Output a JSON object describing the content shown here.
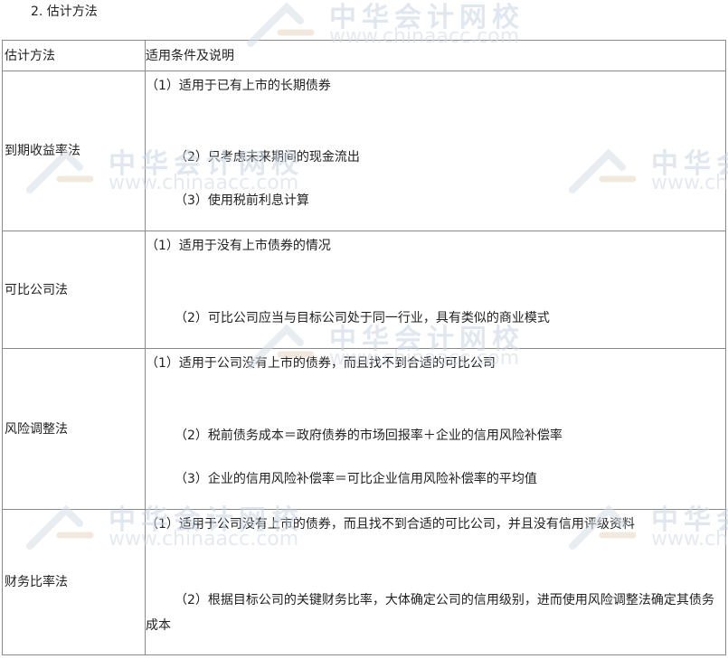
{
  "heading": "2. 估计方法",
  "table": {
    "header": [
      "估计方法",
      "适用条件及说明"
    ],
    "rows": [
      {
        "method": "到期收益率法",
        "conditions": [
          "（1）适用于已有上市的长期债券",
          "（2）只考虑未来期间的现金流出",
          "（3）使用税前利息计算"
        ]
      },
      {
        "method": "可比公司法",
        "conditions": [
          "（1）适用于没有上市债券的情况",
          "（2）可比公司应当与目标公司处于同一行业，具有类似的商业模式"
        ]
      },
      {
        "method": "风险调整法",
        "conditions": [
          "（1）适用于公司没有上市的债券，而且找不到合适的可比公司",
          "（2）税前债务成本＝政府债券的市场回报率＋企业的信用风险补偿率",
          "（3）企业的信用风险补偿率＝可比企业信用风险补偿率的平均值"
        ]
      },
      {
        "method": "财务比率法",
        "conditions": [
          "（1）适用于公司没有上市的债券，而且找不到合适的可比公司，并且没有信用评级资料",
          "（2）根据目标公司的关键财务比率，大体确定公司的信用级别，进而使用风险调整法确定其债务成本"
        ]
      }
    ]
  },
  "watermark": {
    "cn": "中华会计网校",
    "url": "www.chinaacc.com"
  },
  "colors": {
    "border": "#8a8a8a",
    "text": "#222222",
    "watermark": "#c9d5e3"
  }
}
